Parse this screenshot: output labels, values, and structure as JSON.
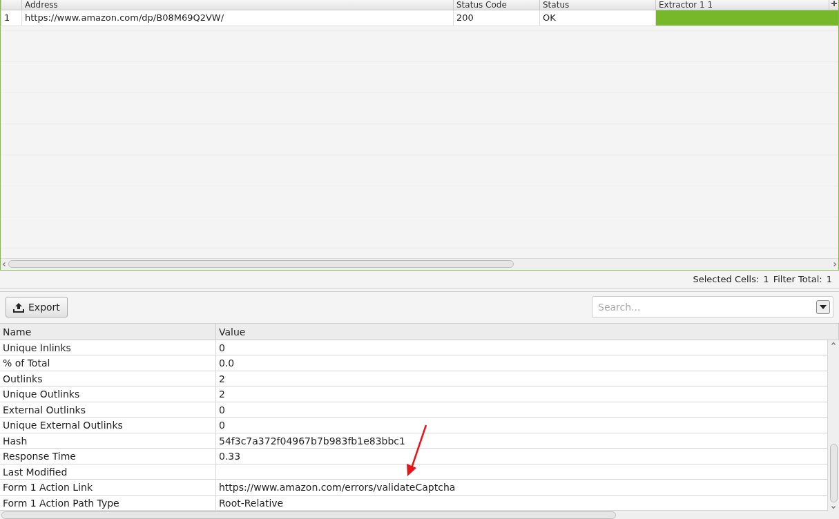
{
  "top_table": {
    "columns": [
      "Address",
      "Status Code",
      "Status",
      "Extractor 1 1"
    ],
    "rows": [
      {
        "index": "1",
        "cells": [
          {
            "text": "https://www.amazon.com/dp/B08M69Q2VW/",
            "selected": false
          },
          {
            "text": "200",
            "selected": false
          },
          {
            "text": "OK",
            "selected": false
          },
          {
            "text": "",
            "selected": true
          }
        ]
      }
    ]
  },
  "status_bar": {
    "selected_cells_label": "Selected Cells:",
    "selected_cells": "1",
    "filter_total_label": "Filter Total:",
    "filter_total": "1"
  },
  "toolbar": {
    "export_label": "Export",
    "search": {
      "placeholder": "Search..."
    }
  },
  "details_table": {
    "columns": [
      "Name",
      "Value"
    ],
    "rows": [
      {
        "name": "Unique Inlinks",
        "value": "0"
      },
      {
        "name": "% of Total",
        "value": "0.0"
      },
      {
        "name": "Outlinks",
        "value": "2"
      },
      {
        "name": "Unique Outlinks",
        "value": "2"
      },
      {
        "name": "External Outlinks",
        "value": "0"
      },
      {
        "name": "Unique External Outlinks",
        "value": "0"
      },
      {
        "name": "Hash",
        "value": "54f3c7a372f04967b7b983fb1e83bbc1"
      },
      {
        "name": "Response Time",
        "value": "0.33"
      },
      {
        "name": "Last Modified",
        "value": ""
      },
      {
        "name": "Form 1 Action Link",
        "value": "https://www.amazon.com/errors/validateCaptcha"
      },
      {
        "name": "Form 1 Action Path Type",
        "value": "Root-Relative"
      }
    ]
  }
}
